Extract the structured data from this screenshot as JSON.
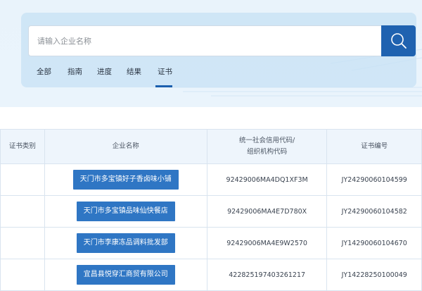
{
  "search": {
    "placeholder": "请输入企业名称",
    "button_icon": "search-icon"
  },
  "tabs": [
    {
      "label": "全部"
    },
    {
      "label": "指南"
    },
    {
      "label": "进度"
    },
    {
      "label": "结果"
    },
    {
      "label": "证书",
      "active": true
    }
  ],
  "table": {
    "headers": [
      "证书类别",
      "企业名称",
      "统一社会信用代码/",
      "组织机构代码",
      "证书编号"
    ],
    "rows": [
      {
        "type": "",
        "company": "天门市多宝镇好子香卤味小铺",
        "code": "92429006MA4DQ1XF3M",
        "cert": "JY24290060104599"
      },
      {
        "type": "",
        "company": "天门市多宝镇品味仙快餐店",
        "code": "92429006MA4E7D780X",
        "cert": "JY24290060104582"
      },
      {
        "type": "",
        "company": "天门市李康冻品调料批发部",
        "code": "92429006MA4E9W2570",
        "cert": "JY14290060104670"
      },
      {
        "type": "",
        "company": "宜昌县悦穿汇商贸有限公司",
        "code": "422825197403261217",
        "cert": "JY14228250100049"
      }
    ]
  },
  "colors": {
    "primary": "#1f62b0",
    "button": "#2f76c4",
    "header_bg": "#eef5fc"
  }
}
